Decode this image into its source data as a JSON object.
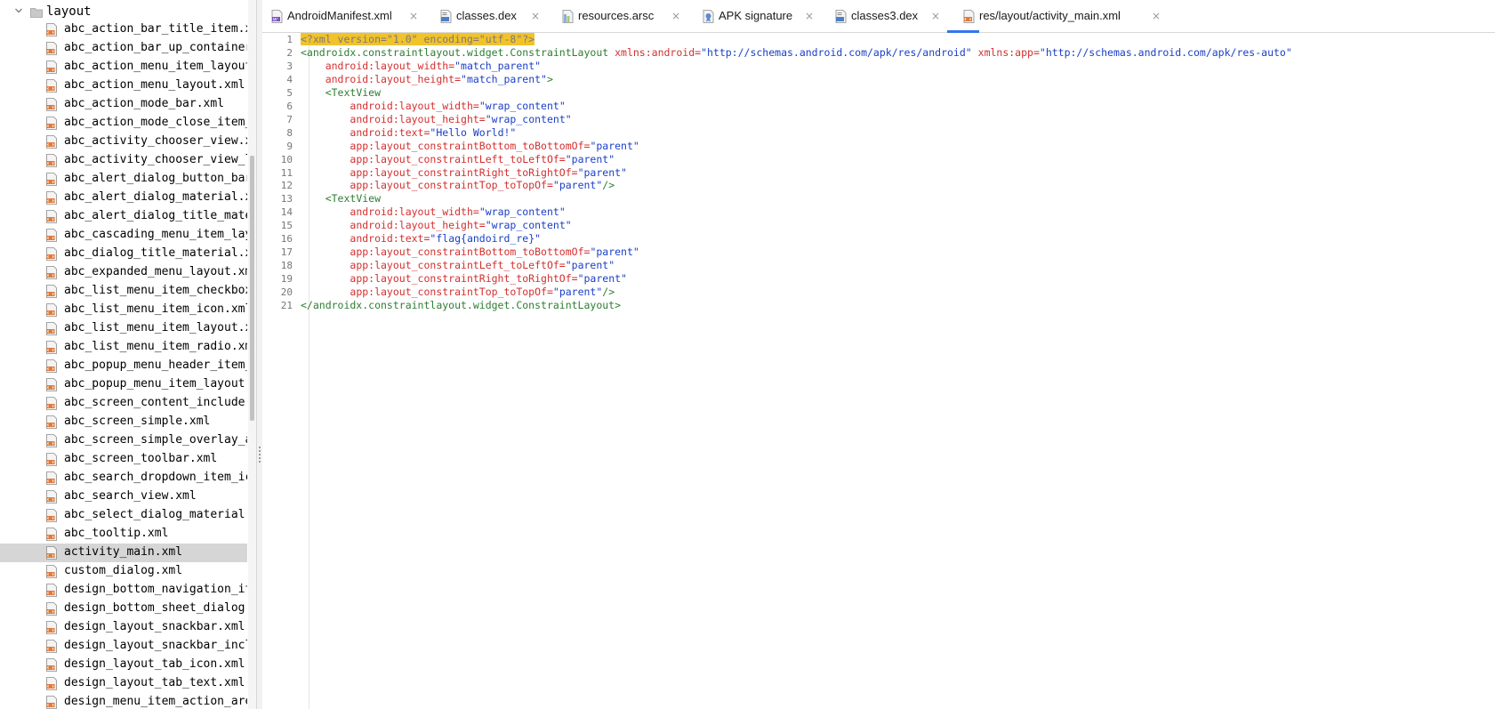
{
  "tree": {
    "folder_label": "layout",
    "items": [
      "abc_action_bar_title_item.xml",
      "abc_action_bar_up_container.xml",
      "abc_action_menu_item_layout.xml",
      "abc_action_menu_layout.xml",
      "abc_action_mode_bar.xml",
      "abc_action_mode_close_item_material.xml",
      "abc_activity_chooser_view.xml",
      "abc_activity_chooser_view_list_item.xml",
      "abc_alert_dialog_button_bar_material.xml",
      "abc_alert_dialog_material.xml",
      "abc_alert_dialog_title_material.xml",
      "abc_cascading_menu_item_layout.xml",
      "abc_dialog_title_material.xml",
      "abc_expanded_menu_layout.xml",
      "abc_list_menu_item_checkbox.xml",
      "abc_list_menu_item_icon.xml",
      "abc_list_menu_item_layout.xml",
      "abc_list_menu_item_radio.xml",
      "abc_popup_menu_header_item_layout.xml",
      "abc_popup_menu_item_layout.xml",
      "abc_screen_content_include.xml",
      "abc_screen_simple.xml",
      "abc_screen_simple_overlay_action_mode.xml",
      "abc_screen_toolbar.xml",
      "abc_search_dropdown_item_icons_2line.xml",
      "abc_search_view.xml",
      "abc_select_dialog_material.xml",
      "abc_tooltip.xml",
      "activity_main.xml",
      "custom_dialog.xml",
      "design_bottom_navigation_item.xml",
      "design_bottom_sheet_dialog.xml",
      "design_layout_snackbar.xml",
      "design_layout_snackbar_include.xml",
      "design_layout_tab_icon.xml",
      "design_layout_tab_text.xml",
      "design_menu_item_action_area.xml"
    ],
    "selected": "activity_main.xml"
  },
  "tabs": [
    {
      "label": "AndroidManifest.xml",
      "icon": "manifest-file-icon",
      "close": "×"
    },
    {
      "label": "classes.dex",
      "icon": "dex-file-icon",
      "close": "×"
    },
    {
      "label": "resources.arsc",
      "icon": "resources-file-icon",
      "close": "×"
    },
    {
      "label": "APK signature",
      "icon": "certificate-icon",
      "close": "×"
    },
    {
      "label": "classes3.dex",
      "icon": "dex-file-icon",
      "close": "×"
    },
    {
      "label": "res/layout/activity_main.xml",
      "icon": "xml-file-icon",
      "close": "×",
      "active": true
    }
  ],
  "editor": {
    "line_numbers": [
      "1",
      "2",
      "3",
      "4",
      "5",
      "6",
      "7",
      "8",
      "9",
      "10",
      "11",
      "12",
      "13",
      "14",
      "15",
      "16",
      "17",
      "18",
      "19",
      "20",
      "21"
    ],
    "lines": [
      [
        [
          "pi",
          "<?xml version=\"1.0\" encoding=\"utf-8\"?>"
        ]
      ],
      [
        [
          "tag",
          "<androidx.constraintlayout.widget.ConstraintLayout "
        ],
        [
          "attr",
          "xmlns:android"
        ],
        [
          "punct",
          "="
        ],
        [
          "val",
          "\"http://schemas.android.com/apk/res/android\""
        ],
        [
          "txt",
          " "
        ],
        [
          "attr",
          "xmlns:app"
        ],
        [
          "punct",
          "="
        ],
        [
          "val",
          "\"http://schemas.android.com/apk/res-auto\""
        ]
      ],
      [
        [
          "txt",
          "    "
        ],
        [
          "attr",
          "android:layout_width"
        ],
        [
          "punct",
          "="
        ],
        [
          "val",
          "\"match_parent\""
        ]
      ],
      [
        [
          "txt",
          "    "
        ],
        [
          "attr",
          "android:layout_height"
        ],
        [
          "punct",
          "="
        ],
        [
          "val",
          "\"match_parent\""
        ],
        [
          "tag",
          ">"
        ]
      ],
      [
        [
          "txt",
          "    "
        ],
        [
          "tag",
          "<TextView"
        ]
      ],
      [
        [
          "txt",
          "        "
        ],
        [
          "attr",
          "android:layout_width"
        ],
        [
          "punct",
          "="
        ],
        [
          "val",
          "\"wrap_content\""
        ]
      ],
      [
        [
          "txt",
          "        "
        ],
        [
          "attr",
          "android:layout_height"
        ],
        [
          "punct",
          "="
        ],
        [
          "val",
          "\"wrap_content\""
        ]
      ],
      [
        [
          "txt",
          "        "
        ],
        [
          "attr",
          "android:text"
        ],
        [
          "punct",
          "="
        ],
        [
          "val",
          "\"Hello World!\""
        ]
      ],
      [
        [
          "txt",
          "        "
        ],
        [
          "attr",
          "app:layout_constraintBottom_toBottomOf"
        ],
        [
          "punct",
          "="
        ],
        [
          "val",
          "\"parent\""
        ]
      ],
      [
        [
          "txt",
          "        "
        ],
        [
          "attr",
          "app:layout_constraintLeft_toLeftOf"
        ],
        [
          "punct",
          "="
        ],
        [
          "val",
          "\"parent\""
        ]
      ],
      [
        [
          "txt",
          "        "
        ],
        [
          "attr",
          "app:layout_constraintRight_toRightOf"
        ],
        [
          "punct",
          "="
        ],
        [
          "val",
          "\"parent\""
        ]
      ],
      [
        [
          "txt",
          "        "
        ],
        [
          "attr",
          "app:layout_constraintTop_toTopOf"
        ],
        [
          "punct",
          "="
        ],
        [
          "val",
          "\"parent\""
        ],
        [
          "tag",
          "/>"
        ]
      ],
      [
        [
          "txt",
          "    "
        ],
        [
          "tag",
          "<TextView"
        ]
      ],
      [
        [
          "txt",
          "        "
        ],
        [
          "attr",
          "android:layout_width"
        ],
        [
          "punct",
          "="
        ],
        [
          "val",
          "\"wrap_content\""
        ]
      ],
      [
        [
          "txt",
          "        "
        ],
        [
          "attr",
          "android:layout_height"
        ],
        [
          "punct",
          "="
        ],
        [
          "val",
          "\"wrap_content\""
        ]
      ],
      [
        [
          "txt",
          "        "
        ],
        [
          "attr",
          "android:text"
        ],
        [
          "punct",
          "="
        ],
        [
          "val",
          "\"flag{andoird_re}\""
        ]
      ],
      [
        [
          "txt",
          "        "
        ],
        [
          "attr",
          "app:layout_constraintBottom_toBottomOf"
        ],
        [
          "punct",
          "="
        ],
        [
          "val",
          "\"parent\""
        ]
      ],
      [
        [
          "txt",
          "        "
        ],
        [
          "attr",
          "app:layout_constraintLeft_toLeftOf"
        ],
        [
          "punct",
          "="
        ],
        [
          "val",
          "\"parent\""
        ]
      ],
      [
        [
          "txt",
          "        "
        ],
        [
          "attr",
          "app:layout_constraintRight_toRightOf"
        ],
        [
          "punct",
          "="
        ],
        [
          "val",
          "\"parent\""
        ]
      ],
      [
        [
          "txt",
          "        "
        ],
        [
          "attr",
          "app:layout_constraintTop_toTopOf"
        ],
        [
          "punct",
          "="
        ],
        [
          "val",
          "\"parent\""
        ],
        [
          "tag",
          "/>"
        ]
      ],
      [
        [
          "tag",
          "</androidx.constraintlayout.widget.ConstraintLayout>"
        ]
      ]
    ]
  },
  "colors": {
    "accent": "#3574f0",
    "tag": "#2e7d32",
    "attribute": "#d32f2f",
    "value": "#1a3fc7",
    "highlight": "#f2c22b",
    "selection": "#d6d6d6"
  }
}
